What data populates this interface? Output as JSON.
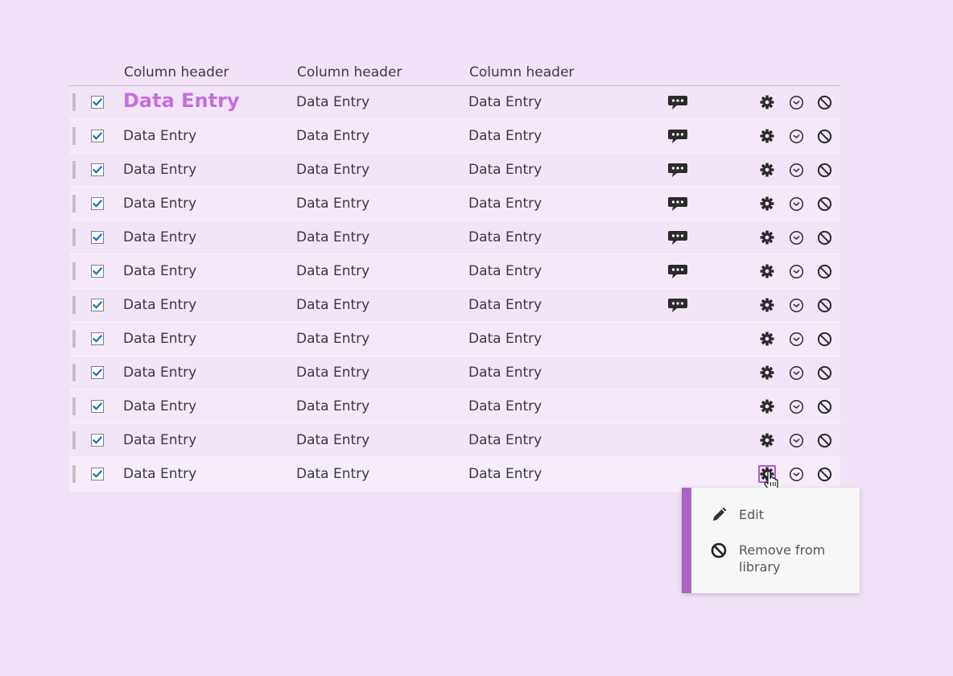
{
  "table": {
    "headers": [
      "Column header",
      "Column header",
      "Column header"
    ],
    "rows": [
      {
        "cells": [
          "Data Entry",
          "Data Entry",
          "Data Entry"
        ],
        "checked": true,
        "comment": true,
        "primary": true
      },
      {
        "cells": [
          "Data Entry",
          "Data Entry",
          "Data Entry"
        ],
        "checked": true,
        "comment": true
      },
      {
        "cells": [
          "Data Entry",
          "Data Entry",
          "Data Entry"
        ],
        "checked": true,
        "comment": true
      },
      {
        "cells": [
          "Data Entry",
          "Data Entry",
          "Data Entry"
        ],
        "checked": true,
        "comment": true
      },
      {
        "cells": [
          "Data Entry",
          "Data Entry",
          "Data Entry"
        ],
        "checked": true,
        "comment": true
      },
      {
        "cells": [
          "Data Entry",
          "Data Entry",
          "Data Entry"
        ],
        "checked": true,
        "comment": true
      },
      {
        "cells": [
          "Data Entry",
          "Data Entry",
          "Data Entry"
        ],
        "checked": true,
        "comment": true
      },
      {
        "cells": [
          "Data Entry",
          "Data Entry",
          "Data Entry"
        ],
        "checked": true,
        "comment": false
      },
      {
        "cells": [
          "Data Entry",
          "Data Entry",
          "Data Entry"
        ],
        "checked": true,
        "comment": false
      },
      {
        "cells": [
          "Data Entry",
          "Data Entry",
          "Data Entry"
        ],
        "checked": true,
        "comment": false
      },
      {
        "cells": [
          "Data Entry",
          "Data Entry",
          "Data Entry"
        ],
        "checked": true,
        "comment": false
      },
      {
        "cells": [
          "Data Entry",
          "Data Entry",
          "Data Entry"
        ],
        "checked": true,
        "comment": false,
        "active_gear": true
      }
    ],
    "row_icons": [
      "comment-icon",
      "gear-icon",
      "clock-icon",
      "ban-icon"
    ]
  },
  "context_menu": {
    "items": [
      {
        "label": "Edit",
        "icon": "pencil-icon"
      },
      {
        "label": "Remove from library",
        "icon": "ban-icon"
      }
    ]
  },
  "colors": {
    "background": "#f1e2f7",
    "accent": "#a865c2",
    "primary_text": "#c46ee0",
    "checkbox": "#1f6fb5"
  }
}
